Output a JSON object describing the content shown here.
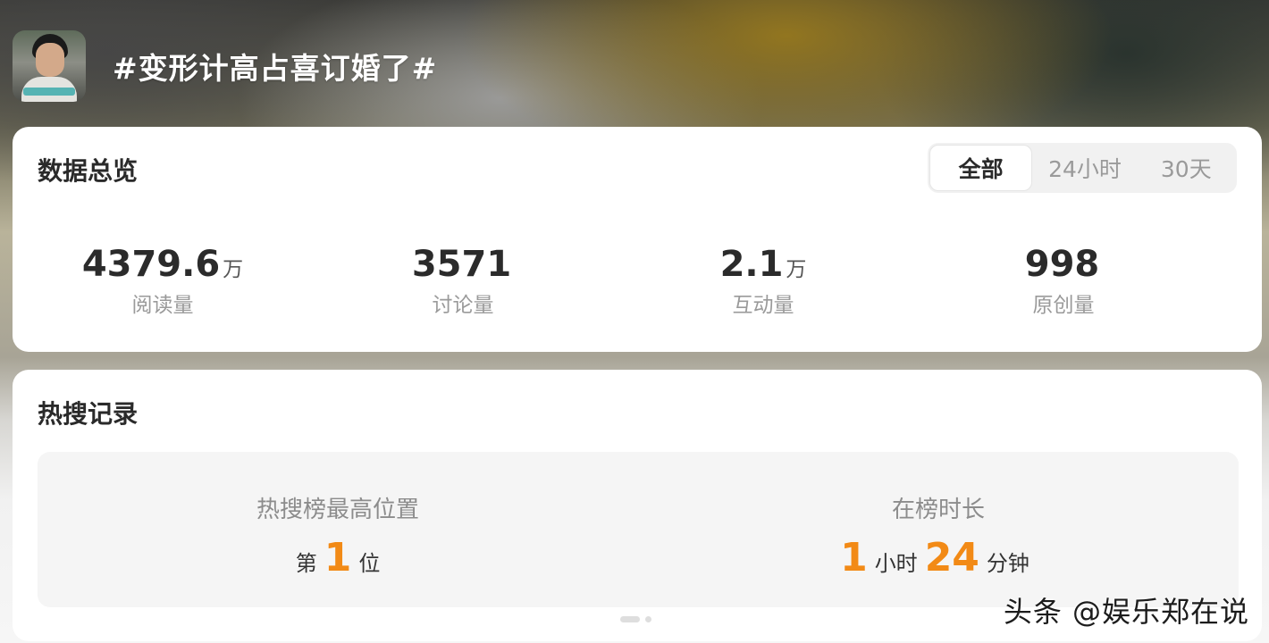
{
  "header": {
    "title": "#变形计高占喜订婚了#"
  },
  "overview": {
    "title": "数据总览",
    "tabs": [
      {
        "label": "全部"
      },
      {
        "label": "24小时"
      },
      {
        "label": "30天"
      }
    ],
    "selected_tab": "全部",
    "stats": [
      {
        "value": "4379.6",
        "unit": "万",
        "label": "阅读量"
      },
      {
        "value": "3571",
        "unit": "",
        "label": "讨论量"
      },
      {
        "value": "2.1",
        "unit": "万",
        "label": "互动量"
      },
      {
        "value": "998",
        "unit": "",
        "label": "原创量"
      }
    ]
  },
  "hot_search": {
    "title": "热搜记录",
    "best_position": {
      "label": "热搜榜最高位置",
      "prefix": "第",
      "value": "1",
      "suffix": "位"
    },
    "duration": {
      "label": "在榜时长",
      "hours": "1",
      "hours_unit": "小时",
      "minutes": "24",
      "minutes_unit": "分钟"
    }
  },
  "watermark": "头条 @娱乐郑在说",
  "colors": {
    "accent": "#f28a16",
    "card_bg": "#ffffff",
    "panel_bg": "#f5f5f5"
  }
}
